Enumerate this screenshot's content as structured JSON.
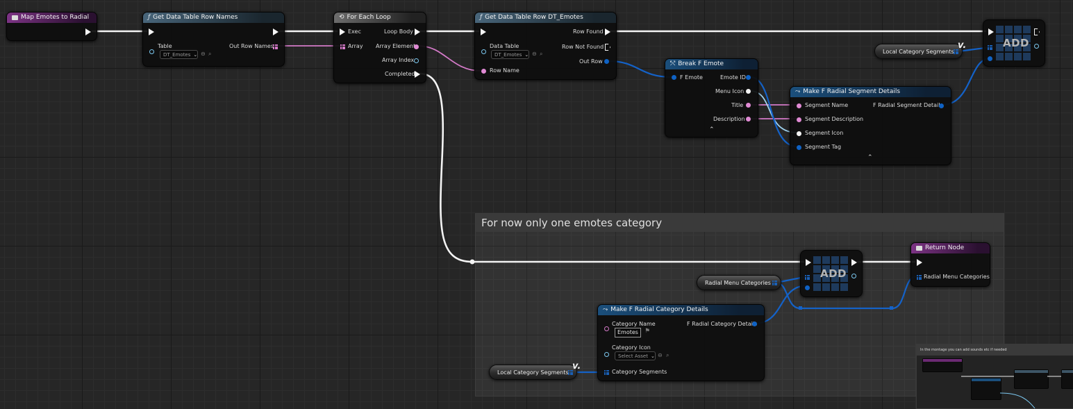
{
  "graph": {
    "comment_title": "For now only one emotes category",
    "nodes": {
      "event": {
        "title": "Map Emotes to Radial"
      },
      "get_row_names": {
        "title": "Get Data Table Row Names",
        "table_label": "Table",
        "table_value": "DT_Emotes",
        "out_label": "Out Row Names"
      },
      "foreach": {
        "title": "For Each Loop",
        "exec": "Exec",
        "array": "Array",
        "loop_body": "Loop Body",
        "array_element": "Array Element",
        "array_index": "Array Index",
        "completed": "Completed"
      },
      "get_row": {
        "title": "Get Data Table Row DT_Emotes",
        "data_table_label": "Data Table",
        "data_table_value": "DT_Emotes",
        "row_name": "Row Name",
        "row_found": "Row Found",
        "row_not_found": "Row Not Found",
        "out_row": "Out Row"
      },
      "break": {
        "title": "Break F Emote",
        "input": "F Emote",
        "emote_id": "Emote ID",
        "menu_icon": "Menu Icon",
        "title_pin": "Title",
        "description": "Description"
      },
      "make_segment": {
        "title": "Make F Radial Segment Details",
        "segment_name": "Segment Name",
        "segment_description": "Segment Description",
        "segment_icon": "Segment Icon",
        "segment_tag": "Segment Tag",
        "output": "F Radial Segment Details"
      },
      "add_top": {
        "label": "ADD"
      },
      "add_bottom": {
        "label": "ADD"
      },
      "return": {
        "title": "Return Node",
        "pin": "Radial Menu Categories"
      },
      "make_category": {
        "title": "Make F Radial Category Details",
        "category_name": "Category Name",
        "category_name_value": "Emotes",
        "category_icon": "Category Icon",
        "select_asset": "Select Asset",
        "category_segments": "Category Segments",
        "output": "F Radial Category Details"
      }
    },
    "variables": {
      "local_segments_top": "Local Category Segments",
      "radial_menu_categories": "Radial Menu Categories",
      "local_segments_bottom": "Local Category Segments"
    },
    "thumbnail": {
      "title": "In the montage you can add sounds etc if needed"
    }
  },
  "colors": {
    "exec": "#f5f5f5",
    "struct": "#0f62c4",
    "name": "#e08ad4",
    "object": "#7cc8f0",
    "background": "#262626"
  },
  "icons": [
    "function-icon",
    "event-icon",
    "loop-macro-icon",
    "break-struct-icon",
    "make-struct-icon",
    "variable-getter-icon",
    "array-icon"
  ]
}
